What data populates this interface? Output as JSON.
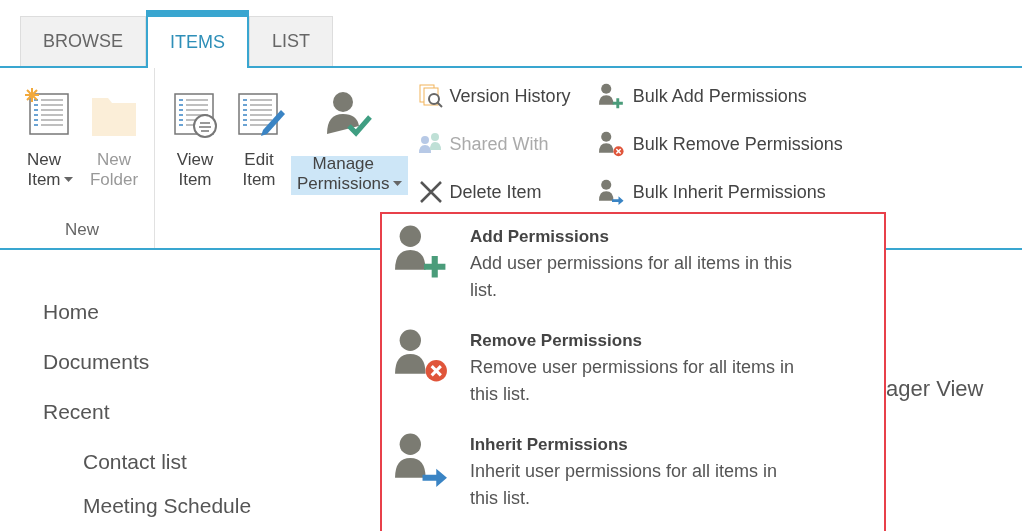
{
  "tabs": [
    {
      "label": "BROWSE",
      "selected": false
    },
    {
      "label": "ITEMS",
      "selected": true
    },
    {
      "label": "LIST",
      "selected": false
    }
  ],
  "ribbon": {
    "groups": [
      {
        "label": "New",
        "large_buttons": [
          {
            "label": "New Item",
            "has_dropdown": true,
            "disabled": false,
            "selected": false
          },
          {
            "label": "New Folder",
            "has_dropdown": false,
            "disabled": true,
            "selected": false
          }
        ]
      },
      {
        "large_buttons": [
          {
            "label": "View Item",
            "has_dropdown": false,
            "disabled": false,
            "selected": false
          },
          {
            "label": "Edit Item",
            "has_dropdown": false,
            "disabled": false,
            "selected": false
          },
          {
            "label": "Manage Permissions",
            "has_dropdown": true,
            "disabled": false,
            "selected": true
          }
        ],
        "small_columns": [
          [
            {
              "label": "Version History",
              "disabled": false
            },
            {
              "label": "Shared With",
              "disabled": true
            },
            {
              "label": "Delete Item",
              "disabled": false
            }
          ],
          [
            {
              "label": "Bulk Add Permissions",
              "disabled": false
            },
            {
              "label": "Bulk Remove Permissions",
              "disabled": false
            },
            {
              "label": "Bulk Inherit Permissions",
              "disabled": false
            }
          ]
        ]
      }
    ]
  },
  "dropdown_menu": {
    "items": [
      {
        "title": "Add Permissions",
        "description": "Add user permissions for all items in this list."
      },
      {
        "title": "Remove Permissions",
        "description": "Remove user permissions for all items in this list."
      },
      {
        "title": "Inherit Permissions",
        "description": "Inherit user permissions for all items in this list."
      }
    ]
  },
  "navigation": {
    "items": [
      {
        "label": "Home"
      },
      {
        "label": "Documents"
      },
      {
        "label": "Recent",
        "children": [
          {
            "label": "Contact list"
          },
          {
            "label": "Meeting Schedule"
          }
        ]
      }
    ]
  },
  "main": {
    "heading_fragment": "ager View"
  }
}
